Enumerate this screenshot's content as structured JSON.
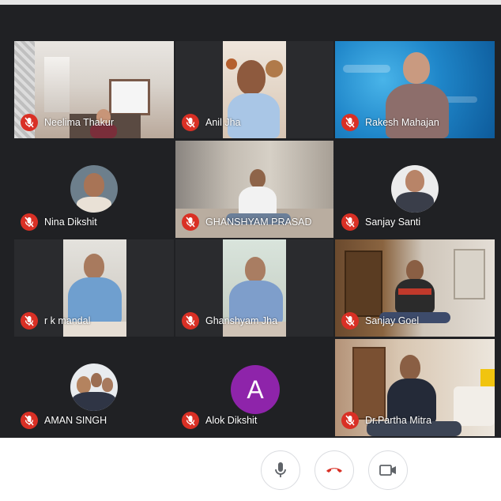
{
  "meeting": {
    "participants": [
      {
        "name": "Neelima Thakur",
        "muted": true,
        "view": "video"
      },
      {
        "name": "Anil Jha",
        "muted": true,
        "view": "video"
      },
      {
        "name": "Rakesh Mahajan",
        "muted": true,
        "view": "video"
      },
      {
        "name": "Nina Dikshit",
        "muted": true,
        "view": "avatar"
      },
      {
        "name": "GHANSHYAM PRASAD",
        "muted": true,
        "view": "video"
      },
      {
        "name": "Sanjay Santi",
        "muted": true,
        "view": "avatar"
      },
      {
        "name": "r k mandal",
        "muted": true,
        "view": "video"
      },
      {
        "name": "Ghanshyam Jha",
        "muted": true,
        "view": "video"
      },
      {
        "name": "Sanjay Goel",
        "muted": true,
        "view": "video"
      },
      {
        "name": "AMAN SINGH",
        "muted": true,
        "view": "avatar"
      },
      {
        "name": "Alok Dikshit",
        "muted": true,
        "view": "letter-avatar",
        "initial": "A",
        "avatar_color": "#8e24aa"
      },
      {
        "name": "Dr.Partha Mitra",
        "muted": true,
        "view": "video"
      }
    ]
  },
  "controls": {
    "icons": [
      "microphone-icon",
      "end-call-icon",
      "camera-icon"
    ],
    "end_call_color": "#d93025"
  },
  "colors": {
    "stage_background": "#202124",
    "mute_badge": "#d93025"
  }
}
